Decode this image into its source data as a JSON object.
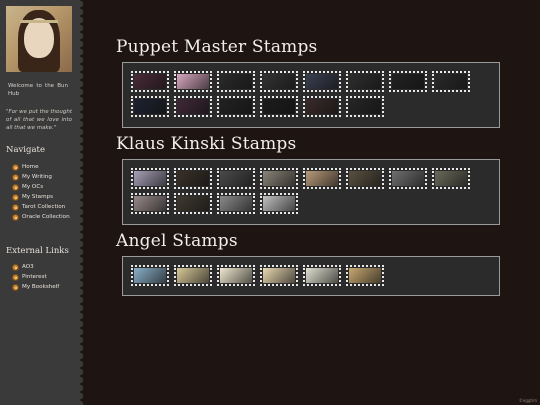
{
  "sidebar": {
    "welcome": "Welcome to the Bun Hub",
    "quote": "\"For we put the thought of all that we love into all that we make.\"",
    "navigate_heading": "Navigate",
    "nav_items": [
      {
        "label": "Home",
        "icon": "bun-icon"
      },
      {
        "label": "My Writing",
        "icon": "bun-icon"
      },
      {
        "label": "My OCs",
        "icon": "bun-icon"
      },
      {
        "label": "My Stamps",
        "icon": "bun-icon"
      },
      {
        "label": "Tarot Collection",
        "icon": "bun-icon"
      },
      {
        "label": "Oracle Collection",
        "icon": "bun-icon"
      }
    ],
    "external_heading": "External Links",
    "external_items": [
      {
        "label": "AO3",
        "icon": "bun-icon"
      },
      {
        "label": "Pinterest",
        "icon": "bun-icon"
      },
      {
        "label": "My Bookshelf",
        "icon": "bun-icon"
      }
    ]
  },
  "sections": [
    {
      "title": "Puppet Master Stamps",
      "stamp_colors": [
        "#4a2a38",
        "#d8a8c0",
        "#2a2a2a",
        "#333",
        "#3a3f50",
        "#2e2e2e",
        "#222",
        "#2a2a2a",
        "#1e2230",
        "#402838",
        "#222",
        "#1c1c1c",
        "#3a2a2a",
        "#262626"
      ]
    },
    {
      "title": "Klaus Kinski Stamps",
      "stamp_colors": [
        "#a8a0b8",
        "#3a3028",
        "#4a4a4a",
        "#8a8478",
        "#b89a7a",
        "#5a5040",
        "#707070",
        "#6a6a5a",
        "#9a8a8a",
        "#403a30",
        "#8a8a8a",
        "#c0c0c0"
      ]
    },
    {
      "title": "Angel Stamps",
      "stamp_colors": [
        "#8ab0c8",
        "#d8c898",
        "#f0e8d0",
        "#e8d8b0",
        "#e0e0d0",
        "#c8a870"
      ]
    }
  ],
  "footer": "©eggtim"
}
